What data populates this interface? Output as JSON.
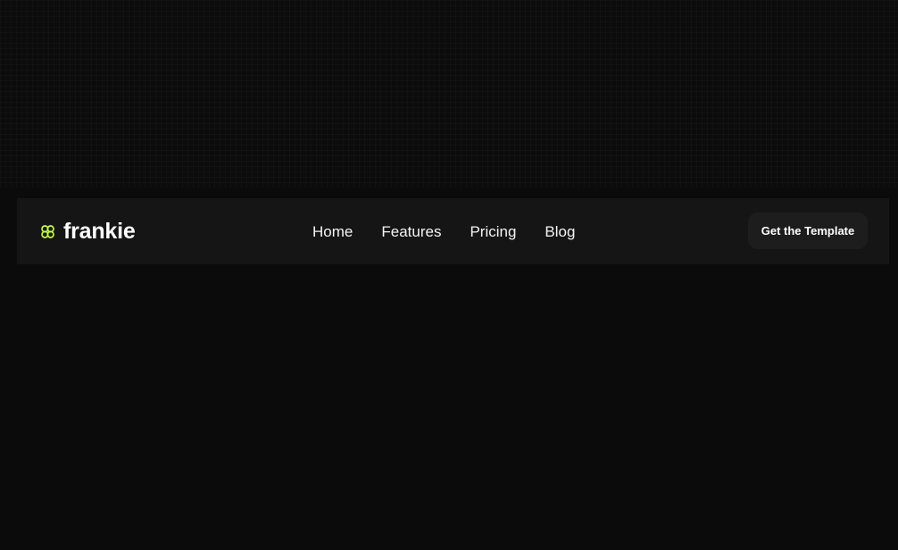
{
  "brand": {
    "name": "frankie",
    "icon": "flower-logo-icon",
    "accent_color": "#c6ff3d"
  },
  "nav": {
    "items": [
      {
        "label": "Home"
      },
      {
        "label": "Features"
      },
      {
        "label": "Pricing"
      },
      {
        "label": "Blog"
      }
    ]
  },
  "cta": {
    "label": "Get the Template"
  },
  "colors": {
    "background": "#0b0b0b",
    "navbar": "#151515",
    "button": "#1d1d1d",
    "text": "#ffffff"
  }
}
